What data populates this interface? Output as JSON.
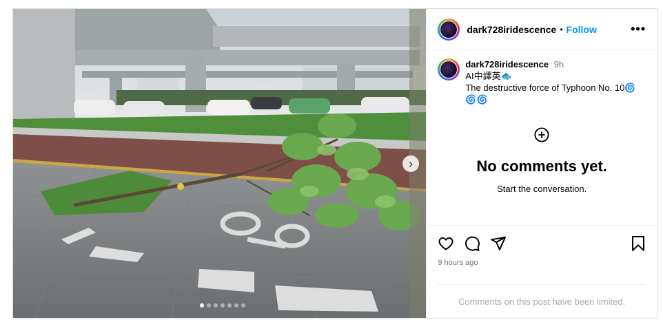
{
  "post": {
    "username": "dark728iridescence",
    "separator": "•",
    "follow_label": "Follow",
    "more_label": "•••",
    "caption": {
      "username": "dark728iridescence",
      "time": "9h",
      "line1": "AI中譯英🐟",
      "line2": "The destructive force of Typhoon No. 10🌀",
      "line3": "🌀🌀"
    },
    "empty_title": "No comments yet.",
    "empty_sub": "Start the conversation.",
    "posted_time": "9 hours ago",
    "limited_text": "Comments on this post have been limited.",
    "carousel": {
      "total": 7,
      "active_index": 0
    }
  },
  "icons": {
    "like": "heart-icon",
    "comment": "comment-icon",
    "share": "share-icon",
    "save": "bookmark-icon",
    "add_comment": "plus-circle-icon",
    "next": "chevron-right-icon"
  },
  "colors": {
    "follow": "#0095f6",
    "muted": "#737373",
    "limited": "#a8a8a8",
    "border": "#dbdbdb"
  }
}
